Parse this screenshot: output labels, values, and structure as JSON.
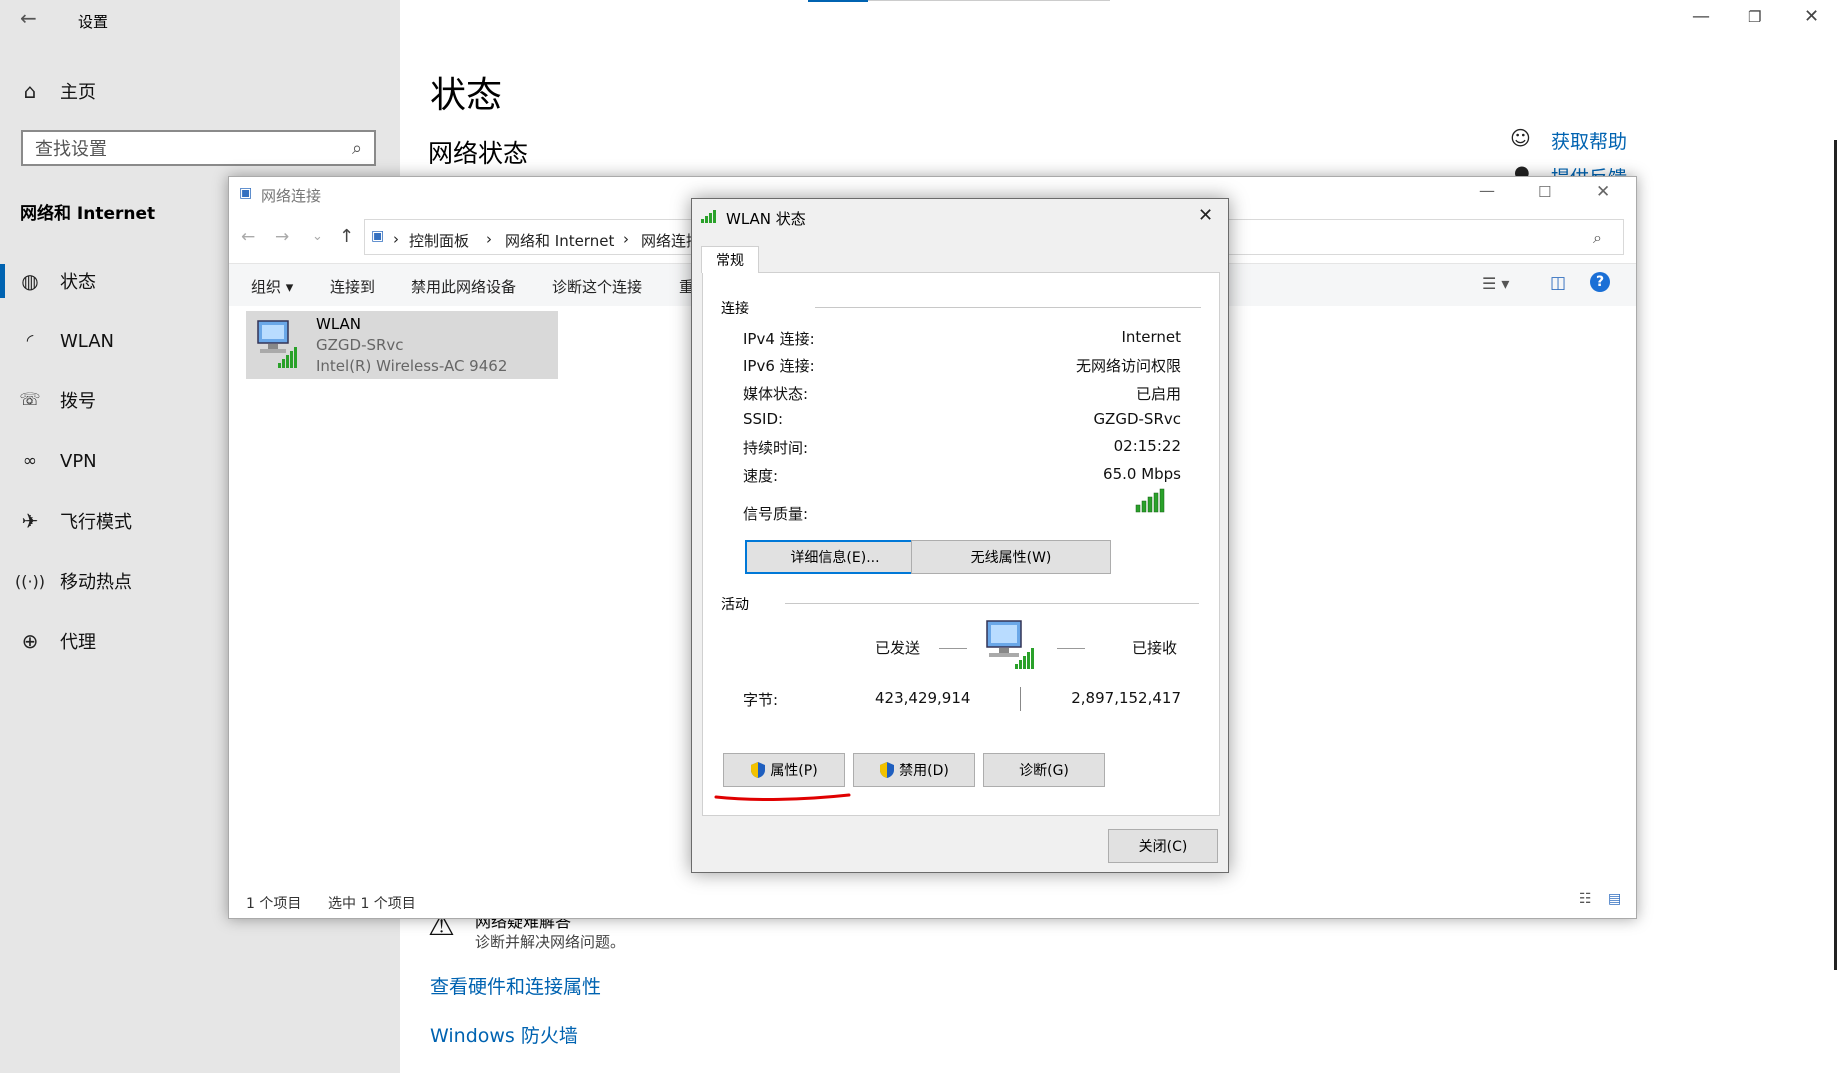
{
  "settings": {
    "title": "设置",
    "home": "主页",
    "search_placeholder": "查找设置",
    "category": "网络和 Internet",
    "nav": [
      {
        "label": "状态"
      },
      {
        "label": "WLAN"
      },
      {
        "label": "拨号"
      },
      {
        "label": "VPN"
      },
      {
        "label": "飞行模式"
      },
      {
        "label": "移动热点"
      },
      {
        "label": "代理"
      }
    ],
    "page_title": "状态",
    "section_title": "网络状态",
    "help_link": "获取帮助",
    "feedback_link": "提供反馈",
    "troubleshoot_title": "网络疑难解答",
    "troubleshoot_desc": "诊断并解决网络问题。",
    "hardware_link": "查看硬件和连接属性",
    "firewall_link": "Windows 防火墙"
  },
  "explorer": {
    "title": "网络连接",
    "breadcrumb": [
      "控制面板",
      "网络和 Internet",
      "网络连接"
    ],
    "commands": [
      "组织 ▾",
      "连接到",
      "禁用此网络设备",
      "诊断这个连接",
      "重"
    ],
    "item": {
      "name": "WLAN",
      "ssid": "GZGD-SRvc",
      "adapter": "Intel(R) Wireless-AC 9462"
    },
    "status_count": "1 个项目",
    "status_selected": "选中 1 个项目"
  },
  "dialog": {
    "title": "WLAN 状态",
    "tab": "常规",
    "connection_group": "连接",
    "rows": [
      {
        "label": "IPv4 连接:",
        "value": "Internet"
      },
      {
        "label": "IPv6 连接:",
        "value": "无网络访问权限"
      },
      {
        "label": "媒体状态:",
        "value": "已启用"
      },
      {
        "label": "SSID:",
        "value": "GZGD-SRvc"
      },
      {
        "label": "持续时间:",
        "value": "02:15:22"
      },
      {
        "label": "速度:",
        "value": "65.0 Mbps"
      }
    ],
    "signal_label": "信号质量:",
    "details_button": "详细信息(E)...",
    "wireless_button": "无线属性(W)",
    "activity_group": "活动",
    "sent_label": "已发送",
    "received_label": "已接收",
    "bytes_label": "字节:",
    "bytes_sent": "423,429,914",
    "bytes_received": "2,897,152,417",
    "properties_button": "属性(P)",
    "disable_button": "禁用(D)",
    "diagnose_button": "诊断(G)",
    "close_button": "关闭(C)"
  },
  "colors": {
    "accent": "#0063b1",
    "underline": "#e00000",
    "signal": "#2aa12a"
  }
}
